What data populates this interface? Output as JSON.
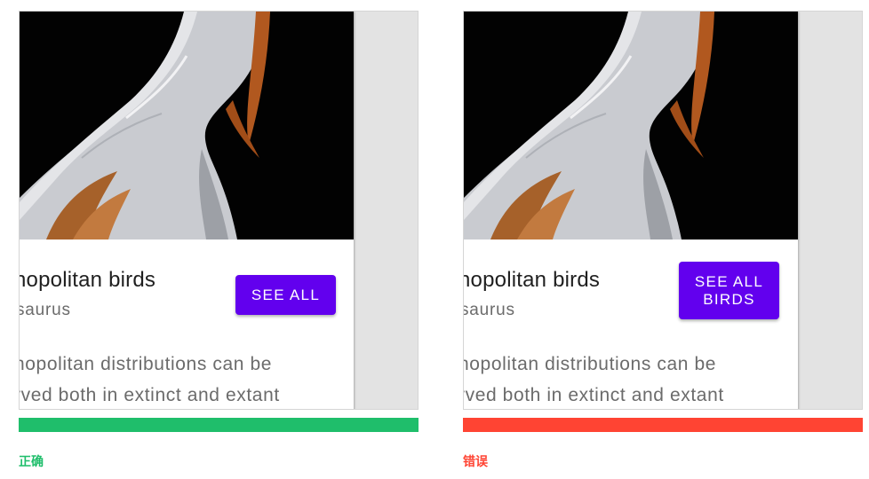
{
  "examples": [
    {
      "card": {
        "title": "nopolitan birds",
        "subtitle": "saurus",
        "body_line1": "nopolitan distributions can be",
        "body_line2": "rved both in extinct and extant",
        "button_label": "SEE ALL"
      },
      "verdict": {
        "label": "正确",
        "color": "#1fbe6b"
      }
    },
    {
      "card": {
        "title": "nopolitan birds",
        "subtitle": "saurus",
        "body_line1": "nopolitan distributions can be",
        "body_line2": "rved both in extinct and extant",
        "button_label": "SEE ALL BIRDS"
      },
      "verdict": {
        "label": "错误",
        "color": "#ff4433"
      }
    }
  ],
  "theme": {
    "button_color": "#6200ee",
    "panel_color": "#e3e3e3"
  },
  "icons": {
    "media": "bird-photo"
  }
}
